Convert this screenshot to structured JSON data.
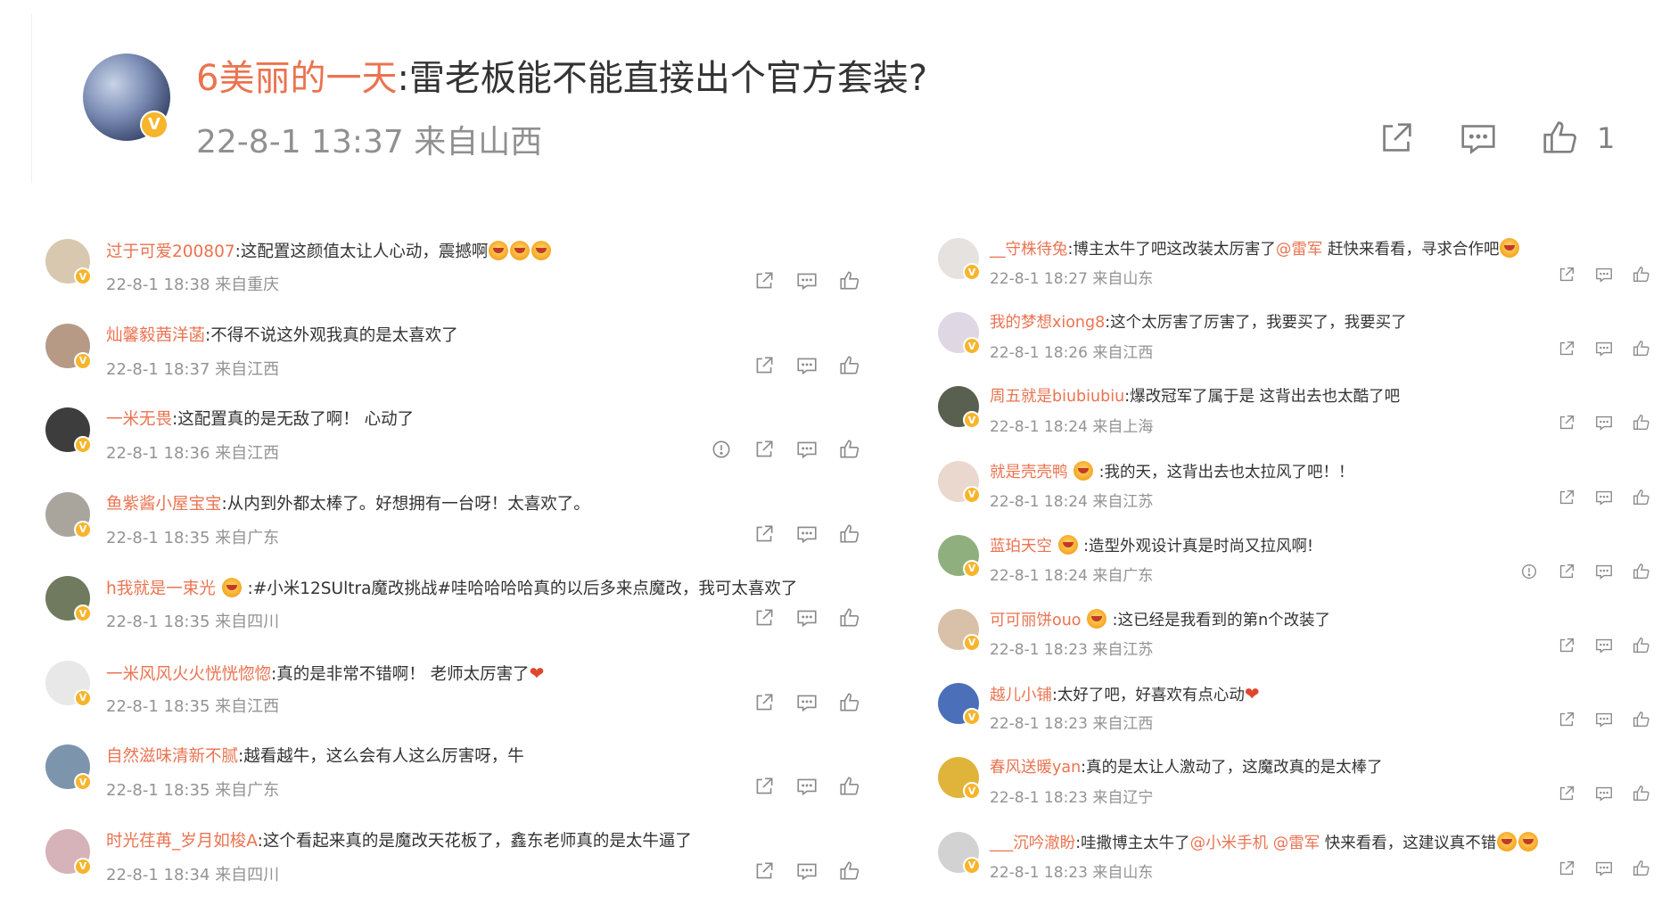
{
  "post": {
    "author": "6美丽的一天",
    "content": ":雷老板能不能直接出个官方套装?",
    "meta": "22-8-1 13:37 来自山西",
    "like_count": "1"
  },
  "comments_left": [
    {
      "name": "过于可爱200807",
      "pre": "",
      "text": ":这配置这颜值太让人心动，震撼啊",
      "emoji": 3,
      "heart": false,
      "meta": "22-8-1 18:38 来自重庆",
      "report": false,
      "avatar": "#d9c8b0"
    },
    {
      "name": "灿馨毅茜洋菡",
      "pre": "",
      "text": ":不得不说这外观我真的是太喜欢了",
      "emoji": 0,
      "heart": false,
      "meta": "22-8-1 18:37 来自江西",
      "report": false,
      "avatar": "#b69a86"
    },
    {
      "name": "一米无畏",
      "pre": "",
      "text": ":这配置真的是无敌了啊！ 心动了",
      "emoji": 0,
      "heart": false,
      "meta": "22-8-1 18:36 来自江西",
      "report": true,
      "avatar": "#3d3d3d"
    },
    {
      "name": "鱼紫酱小屋宝宝",
      "pre": "",
      "text": ":从内到外都太棒了。好想拥有一台呀！太喜欢了。",
      "emoji": 0,
      "heart": false,
      "meta": "22-8-1 18:35 来自广东",
      "report": false,
      "avatar": "#a9a59d"
    },
    {
      "name": "h我就是一束光",
      "pre": " ",
      "text": ":#小米12SUltra魔改挑战#哇哈哈哈哈真的以后多来点魔改，我可太喜欢了",
      "emoji": 0,
      "heart": false,
      "meta": "22-8-1 18:35 来自四川",
      "report": false,
      "avatar": "#6f7a5e"
    },
    {
      "name": "一米风风火火恍恍惚惚",
      "pre": "",
      "text": ":真的是非常不错啊！ 老师太厉害了",
      "emoji": 0,
      "heart": true,
      "meta": "22-8-1 18:35 来自江西",
      "report": false,
      "avatar": "#e8e8e8"
    },
    {
      "name": "自然滋味清新不腻",
      "pre": "",
      "text": ":越看越牛，这么会有人这么厉害呀，牛",
      "emoji": 0,
      "heart": false,
      "meta": "22-8-1 18:35 来自广东",
      "report": false,
      "avatar": "#7d94ad"
    },
    {
      "name": "时光荏苒_岁月如梭A",
      "pre": "",
      "text": ":这个看起来真的是魔改天花板了，鑫东老师真的是太牛逼了",
      "emoji": 0,
      "heart": false,
      "meta": "22-8-1 18:34 来自四川",
      "report": false,
      "avatar": "#d6b3b8"
    }
  ],
  "comments_right": [
    {
      "name": "__守株待兔",
      "pre": "",
      "text": ":博主太牛了吧这改装太厉害了",
      "mention": "@雷军",
      "tail": " 赶快来看看，寻求合作吧",
      "emoji": 1,
      "heart": false,
      "meta": "22-8-1 18:27 来自山东",
      "report": false,
      "avatar": "#e6e2df"
    },
    {
      "name": "我的梦想xiong8",
      "pre": "",
      "text": ":这个太厉害了厉害了，我要买了，我要买了",
      "mention": "",
      "tail": "",
      "emoji": 0,
      "heart": false,
      "meta": "22-8-1 18:26 来自江西",
      "report": false,
      "avatar": "#dfd7e3"
    },
    {
      "name": "周五就是biubiubiu",
      "pre": "",
      "text": ":爆改冠军了属于是 这背出去也太酷了吧",
      "mention": "",
      "tail": "",
      "emoji": 0,
      "heart": false,
      "meta": "22-8-1 18:24 来自上海",
      "report": false,
      "avatar": "#59604f"
    },
    {
      "name": "就是壳壳鸭",
      "pre": " ",
      "text": ":我的天，",
      "mention": "",
      "tail": "这背出去也太拉风了吧！！",
      "emoji": 0,
      "heart": false,
      "meta": "22-8-1 18:24 来自江苏",
      "report": false,
      "avatar": "#ead8cf"
    },
    {
      "name": "蓝珀天空",
      "pre": " ",
      "text": ":造型外观设计真是时尚又拉风啊!",
      "mention": "",
      "tail": "",
      "emoji": 0,
      "heart": false,
      "meta": "22-8-1 18:24 来自广东",
      "report": true,
      "avatar": "#8fb07e"
    },
    {
      "name": "可可丽饼ouo",
      "pre": " ",
      "text": ":这已经是我看到的第n个改装了",
      "mention": "",
      "tail": "",
      "emoji": 0,
      "heart": false,
      "meta": "22-8-1 18:23 来自江苏",
      "report": false,
      "avatar": "#d9c0a8"
    },
    {
      "name": "越儿小铺",
      "pre": "",
      "text": ":太好了吧，好喜欢有点心动",
      "mention": "",
      "tail": "",
      "emoji": 0,
      "heart": true,
      "meta": "22-8-1 18:23 来自江西",
      "report": false,
      "avatar": "#4b6fb8"
    },
    {
      "name": "春风送暖yan",
      "pre": "",
      "text": ":真的是太让人激动了，这魔改真的是太棒了",
      "mention": "",
      "tail": "",
      "emoji": 0,
      "heart": false,
      "meta": "22-8-1 18:23 来自辽宁",
      "report": false,
      "avatar": "#e0b33a"
    },
    {
      "name": "___沉吟澈盼",
      "pre": "",
      "text": ":哇撒博主太牛了",
      "mention": "@小米手机 @雷军",
      "tail": " 快来看看，这建议真不错",
      "emoji": 2,
      "heart": false,
      "meta": "22-8-1 18:23 来自山东",
      "report": false,
      "avatar": "#d2d2d2"
    }
  ]
}
